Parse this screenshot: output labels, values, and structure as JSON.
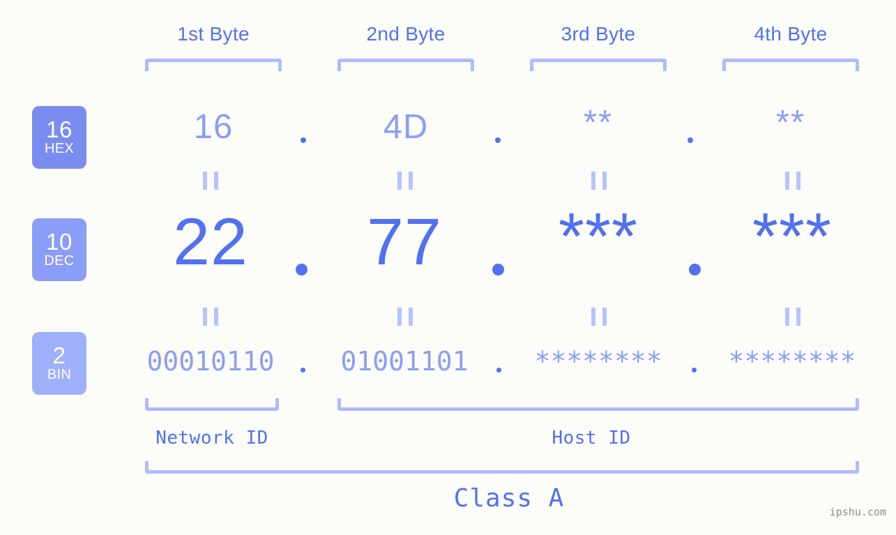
{
  "theme": {
    "background": "#fcfdf9",
    "accent_strong": "#5271ef",
    "accent_light": "#8b9df6",
    "bracket": "#aebcfb",
    "eq_mark": "#b7c3fb",
    "badge_hex_bg": "#7b8cf0",
    "badge_dec_bg": "#8b9df6",
    "badge_bin_bg": "#9fb0fa",
    "badge_text": "#ffffff",
    "watermark": "#8b8b8b"
  },
  "header": {
    "bytes": [
      {
        "label": "1st Byte"
      },
      {
        "label": "2nd Byte"
      },
      {
        "label": "3rd Byte"
      },
      {
        "label": "4th Byte"
      }
    ]
  },
  "radix_badges": [
    {
      "num": "16",
      "name": "HEX"
    },
    {
      "num": "10",
      "name": "DEC"
    },
    {
      "num": "2",
      "name": "BIN"
    }
  ],
  "rows": {
    "hex": {
      "radix": "16",
      "radix_name": "HEX",
      "values": [
        "16",
        "4D",
        "**",
        "**"
      ],
      "separator": "."
    },
    "dec": {
      "radix": "10",
      "radix_name": "DEC",
      "values": [
        "22",
        "77",
        "***",
        "***"
      ],
      "separator": "."
    },
    "bin": {
      "radix": "2",
      "radix_name": "BIN",
      "values": [
        "00010110",
        "01001101",
        "********",
        "********"
      ],
      "separator": "."
    }
  },
  "equality_marks": {
    "symbol": "||",
    "count_per_row": 4,
    "rows": 2
  },
  "footer": {
    "network_id_label": "Network ID",
    "host_id_label": "Host ID",
    "class_label": "Class A"
  },
  "watermark": {
    "text": "ipshu.com"
  }
}
